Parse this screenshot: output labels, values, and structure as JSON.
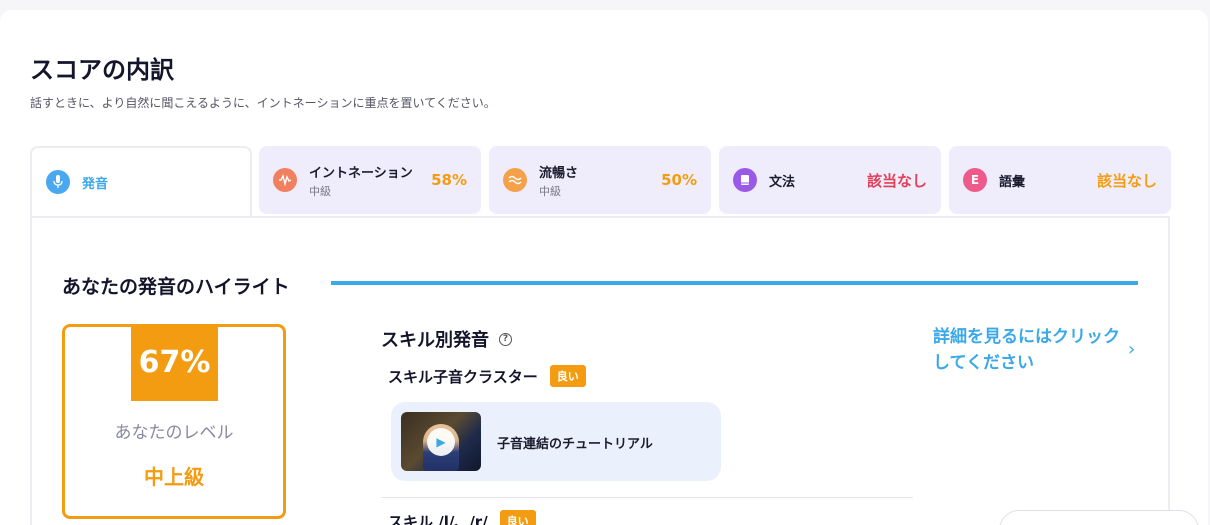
{
  "header": {
    "title": "スコアの内訳",
    "subtitle": "話すときに、より自然に聞こえるように、イントネーションに重点を置いてください。"
  },
  "tabs": [
    {
      "label": "発音",
      "sub": "",
      "score": "",
      "icon": "microphone-icon",
      "color": "#4aa8f0",
      "score_color": ""
    },
    {
      "label": "イントネーション",
      "sub": "中級",
      "score": "58%",
      "icon": "waveform-icon",
      "color": "#f08060",
      "score_color": "#f39c12"
    },
    {
      "label": "流暢さ",
      "sub": "中級",
      "score": "50%",
      "icon": "fluency-icon",
      "color": "#f5a04a",
      "score_color": "#f39c12"
    },
    {
      "label": "文法",
      "sub": "",
      "score": "該当なし",
      "icon": "book-icon",
      "color": "#9b59e8",
      "score_color": "#e0405a"
    },
    {
      "label": "語彙",
      "sub": "",
      "score": "該当なし",
      "icon": "vocab-icon",
      "icon_letter": "E",
      "color": "#ee5a8a",
      "score_color": "#f39c12"
    }
  ],
  "highlight": {
    "title": "あなたの発音のハイライト"
  },
  "level": {
    "percent": "67%",
    "label": "あなたのレベル",
    "value": "中上級"
  },
  "skills": {
    "title": "スキル別発音",
    "detail_link": "詳細を見るにはクリックしてください",
    "items": [
      {
        "name": "スキル子音クラスター",
        "badge": "良い"
      },
      {
        "name": "スキル /l/、/r/",
        "badge": "良い"
      }
    ],
    "tutorial": {
      "label": "子音連結のチュートリアル"
    }
  },
  "colors": {
    "accent": "#3ba8e8",
    "orange": "#f39c12",
    "tab_bg": "#efedfb"
  }
}
